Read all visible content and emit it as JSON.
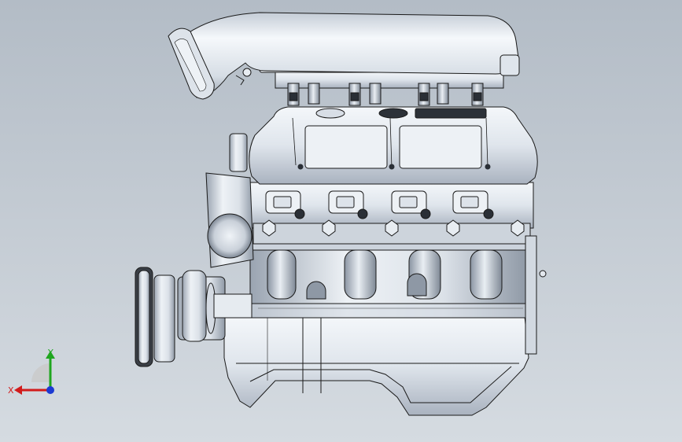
{
  "viewport": {
    "background_top": "#b3bcc6",
    "background_bottom": "#d5dbe1",
    "content": "engine-assembly-side-view"
  },
  "triad": {
    "x_label": "X",
    "y_label": "Y",
    "x_color": "#d21c1c",
    "y_color": "#1fa61f",
    "z_color": "#1c3ad2"
  },
  "model": {
    "edge_color": "#1a1a1a",
    "face_color": "#e4e9f0",
    "shade_color": "#a9b2bf"
  }
}
